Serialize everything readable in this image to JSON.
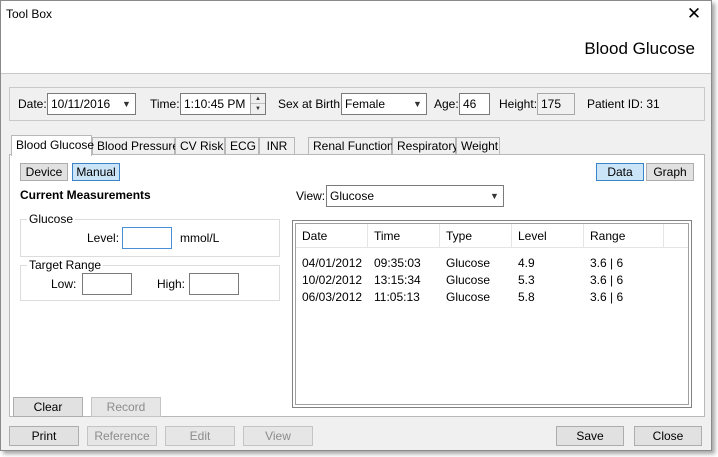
{
  "window": {
    "title": "Tool Box",
    "close_glyph": "✕"
  },
  "header": {
    "title": "Blood Glucose"
  },
  "patient": {
    "date_label": "Date:",
    "date_value": "10/11/2016",
    "time_label": "Time:",
    "time_value": "1:10:45 PM",
    "sex_label": "Sex at Birth:",
    "sex_value": "Female",
    "age_label": "Age:",
    "age_value": "46",
    "height_label": "Height:",
    "height_value": "175",
    "patient_id_label": "Patient ID: 31"
  },
  "tabs": [
    {
      "label": "Blood Glucose"
    },
    {
      "label": "Blood Pressure"
    },
    {
      "label": "CV Risk"
    },
    {
      "label": "ECG"
    },
    {
      "label": "INR"
    },
    {
      "label": "Renal Function"
    },
    {
      "label": "Respiratory"
    },
    {
      "label": "Weight"
    }
  ],
  "mode_buttons": {
    "device": "Device",
    "manual": "Manual",
    "data": "Data",
    "graph": "Graph"
  },
  "measurements": {
    "section_title": "Current Measurements",
    "glucose_group": "Glucose",
    "level_label": "Level:",
    "level_value": "",
    "unit": "mmol/L",
    "target_group": "Target Range",
    "low_label": "Low:",
    "low_value": "",
    "high_label": "High:",
    "high_value": ""
  },
  "view": {
    "label": "View:",
    "value": "Glucose"
  },
  "table": {
    "columns": [
      "Date",
      "Time",
      "Type",
      "Level",
      "Range"
    ],
    "rows": [
      [
        "04/01/2012",
        "09:35:03",
        "Glucose",
        "4.9",
        "3.6 | 6"
      ],
      [
        "10/02/2012",
        "13:15:34",
        "Glucose",
        "5.3",
        "3.6 | 6"
      ],
      [
        "06/03/2012",
        "11:05:13",
        "Glucose",
        "5.8",
        "3.6 | 6"
      ]
    ]
  },
  "actions": {
    "clear": "Clear",
    "record": "Record",
    "print": "Print",
    "reference": "Reference",
    "edit": "Edit",
    "view": "View",
    "save": "Save",
    "close": "Close"
  }
}
